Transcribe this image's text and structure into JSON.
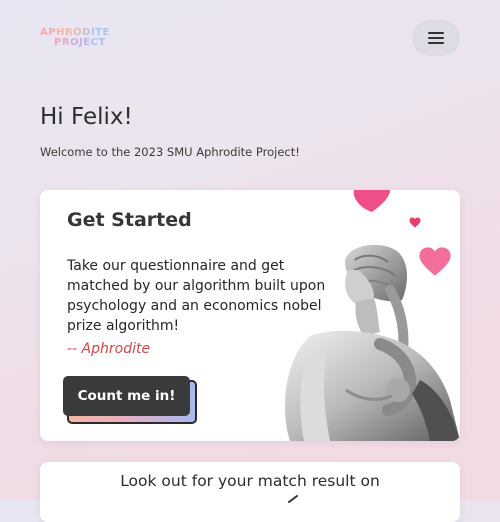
{
  "header": {
    "logo_line1": "APHRODITE",
    "logo_line2": "PROJECT",
    "menu_icon": "hamburger-menu-icon"
  },
  "greeting": {
    "title": "Hi Felix!",
    "subtitle": "Welcome to the 2023 SMU Aphrodite Project!"
  },
  "get_started_card": {
    "title": "Get Started",
    "body": "Take our questionnaire and get matched by our algorithm built upon psychology and an economics nobel prize algorithm!",
    "signature": "-- Aphrodite",
    "cta_label": "Count me in!",
    "image": "aphrodite-statue",
    "decorations": [
      "heart-icon",
      "heart-icon",
      "heart-icon"
    ]
  },
  "match_card": {
    "text": "Look out for your match result on"
  },
  "colors": {
    "signature": "#d64547",
    "heart": "#f0568c",
    "button": "#3a3a3a",
    "menu_button_bg": "#dddbe4"
  }
}
